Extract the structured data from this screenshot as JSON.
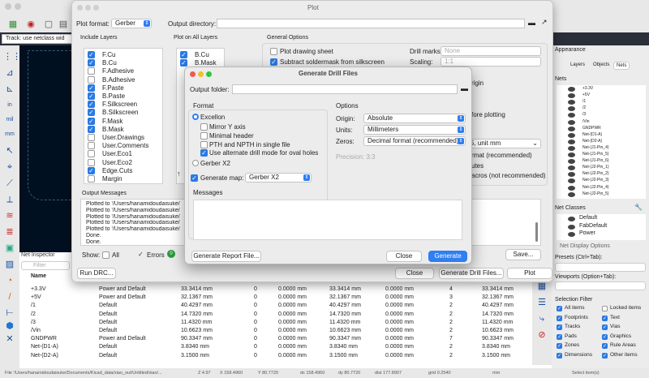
{
  "main": {
    "toolbar_text": "Track: use netclass wid",
    "status_path": "File '/Users/hanamidoudaisuke/Documents/Kicad_data/xiao_out/Untitled/xiao/...",
    "status_z": "Z 4.97",
    "status_x": "X 158.4960",
    "status_y": "Y 80.7720",
    "status_dx": "dx 158.4960",
    "status_dy": "dy 80.7720",
    "status_dist": "dist 177.8907",
    "status_grid": "grid 0.2540",
    "status_unit": "mm",
    "status_select": "Select item(s)"
  },
  "plot": {
    "title": "Plot",
    "plot_format_label": "Plot format:",
    "plot_format_value": "Gerber",
    "output_dir_label": "Output directory:",
    "include_layers_title": "Include Layers",
    "include_layers": [
      {
        "name": "F.Cu",
        "checked": true
      },
      {
        "name": "B.Cu",
        "checked": true
      },
      {
        "name": "F.Adhesive",
        "checked": false
      },
      {
        "name": "B.Adhesive",
        "checked": false
      },
      {
        "name": "F.Paste",
        "checked": true
      },
      {
        "name": "B.Paste",
        "checked": true
      },
      {
        "name": "F.Silkscreen",
        "checked": true
      },
      {
        "name": "B.Silkscreen",
        "checked": true
      },
      {
        "name": "F.Mask",
        "checked": true
      },
      {
        "name": "B.Mask",
        "checked": true
      },
      {
        "name": "User.Drawings",
        "checked": false
      },
      {
        "name": "User.Comments",
        "checked": false
      },
      {
        "name": "User.Eco1",
        "checked": false
      },
      {
        "name": "User.Eco2",
        "checked": false
      },
      {
        "name": "Edge.Cuts",
        "checked": true
      },
      {
        "name": "Margin",
        "checked": false
      }
    ],
    "plot_all_title": "Plot on All Layers",
    "plot_all_layers": [
      {
        "name": "B.Cu",
        "checked": true
      },
      {
        "name": "B.Mask",
        "checked": true
      }
    ],
    "general_title": "General Options",
    "plot_drawing_sheet": "Plot drawing sheet",
    "subtract_soldermask": "Subtract soldermask from silkscreen",
    "drill_marks_label": "Drill marks:",
    "drill_marks_value": "None",
    "scaling_label": "Scaling:",
    "scaling_value": "1:1",
    "frag_origin": "rigin",
    "frag_before": "fore plotting",
    "frag_unit": "5, unit mm",
    "frag_format": "rmat (recommended)",
    "frag_utes": "utes",
    "frag_macros": "acros (not recommended)",
    "output_messages_title": "Output Messages",
    "messages": [
      "Plotted to '/Users/hanamidoudaisuke/",
      "Plotted to '/Users/hanamidoudaisuke/",
      "Plotted to '/Users/hanamidoudaisuke/",
      "Plotted to '/Users/hanamidoudaisuke/",
      "Plotted to '/Users/hanamidoudaisuke/",
      "Done.",
      "Done."
    ],
    "show_label": "Show:",
    "all_label": "All",
    "errors_label": "Errors",
    "errors_count": "0",
    "save_button": "Save...",
    "run_drc": "Run DRC...",
    "close": "Close",
    "generate_drill": "Generate Drill Files...",
    "plot_button": "Plot"
  },
  "drill": {
    "title": "Generate Drill Files",
    "output_folder_label": "Output folder:",
    "format_title": "Format",
    "excellon": "Excellon",
    "mirror_y": "Mirror Y axis",
    "minimal_header": "Minimal header",
    "pth_npth": "PTH and NPTH in single file",
    "alt_drill": "Use alternate drill mode for oval holes",
    "gerber_x2": "Gerber X2",
    "generate_map": "Generate map:",
    "map_format": "Gerber X2",
    "options_title": "Options",
    "origin_label": "Origin:",
    "origin_value": "Absolute",
    "units_label": "Units:",
    "units_value": "Millimeters",
    "zeros_label": "Zeros:",
    "zeros_value": "Decimal format (recommended)",
    "precision": "Precision: 3:3",
    "messages_title": "Messages",
    "generate_report": "Generate Report File...",
    "close": "Close",
    "generate": "Generate"
  },
  "net_inspector": {
    "title": "Net Inspector",
    "filter_placeholder": "Filter",
    "col_name": "Name",
    "rows": [
      [
        "+3.3V",
        "Power and Default",
        "33.3414 mm",
        "0",
        "0.0000 mm",
        "33.3414 mm",
        "0.0000 mm",
        "4",
        "33.3414 mm"
      ],
      [
        "+5V",
        "Power and Default",
        "32.1367 mm",
        "0",
        "0.0000 mm",
        "32.1367 mm",
        "0.0000 mm",
        "3",
        "32.1367 mm"
      ],
      [
        "/1",
        "Default",
        "40.4297 mm",
        "0",
        "0.0000 mm",
        "40.4297 mm",
        "0.0000 mm",
        "2",
        "40.4297 mm"
      ],
      [
        "/2",
        "Default",
        "14.7320 mm",
        "0",
        "0.0000 mm",
        "14.7320 mm",
        "0.0000 mm",
        "2",
        "14.7320 mm"
      ],
      [
        "/3",
        "Default",
        "11.4320 mm",
        "0",
        "0.0000 mm",
        "11.4320 mm",
        "0.0000 mm",
        "2",
        "11.4320 mm"
      ],
      [
        "/Vin",
        "Default",
        "10.6623 mm",
        "0",
        "0.0000 mm",
        "10.6623 mm",
        "0.0000 mm",
        "2",
        "10.6623 mm"
      ],
      [
        "GNDPWR",
        "Power and Default",
        "90.3347 mm",
        "0",
        "0.0000 mm",
        "90.3347 mm",
        "0.0000 mm",
        "7",
        "90.3347 mm"
      ],
      [
        "Net-(D1-A)",
        "Default",
        "3.8340 mm",
        "0",
        "0.0000 mm",
        "3.8340 mm",
        "0.0000 mm",
        "2",
        "3.8340 mm"
      ],
      [
        "Net-(D2-A)",
        "Default",
        "3.1500 mm",
        "0",
        "0.0000 mm",
        "3.1500 mm",
        "0.0000 mm",
        "2",
        "3.1500 mm"
      ]
    ]
  },
  "appearance": {
    "title": "Appearance",
    "tabs": [
      "Layers",
      "Objects",
      "Nets"
    ],
    "nets_title": "Nets",
    "nets": [
      "+3.3V",
      "+5V",
      "/1",
      "/2",
      "/3",
      "/Vin",
      "GNDPWR",
      "Net-(D1-A)",
      "Net-(D2-A)",
      "Net-(J1-Pin_4)",
      "Net-(J1-Pin_5)",
      "Net-(J1-Pin_6)",
      "Net-(J2-Pin_1)",
      "Net-(J2-Pin_2)",
      "Net-(J2-Pin_3)",
      "Net-(J2-Pin_4)",
      "Net-(J2-Pin_5)"
    ],
    "net_classes_title": "Net Classes",
    "net_classes": [
      "Default",
      "FabDefault",
      "Power"
    ],
    "net_display_options": "Net Display Options",
    "presets": "Presets (Ctrl+Tab):",
    "viewports": "Viewports (Option+Tab):",
    "selection_filter": "Selection Filter",
    "filters": [
      {
        "name": "All items",
        "checked": true
      },
      {
        "name": "Locked items",
        "checked": false
      },
      {
        "name": "Footprints",
        "checked": true
      },
      {
        "name": "Text",
        "checked": true
      },
      {
        "name": "Tracks",
        "checked": true
      },
      {
        "name": "Vias",
        "checked": true
      },
      {
        "name": "Pads",
        "checked": true
      },
      {
        "name": "Graphics",
        "checked": true
      },
      {
        "name": "Zones",
        "checked": true
      },
      {
        "name": "Rule Areas",
        "checked": true
      },
      {
        "name": "Dimensions",
        "checked": true
      },
      {
        "name": "Other items",
        "checked": true
      }
    ]
  }
}
